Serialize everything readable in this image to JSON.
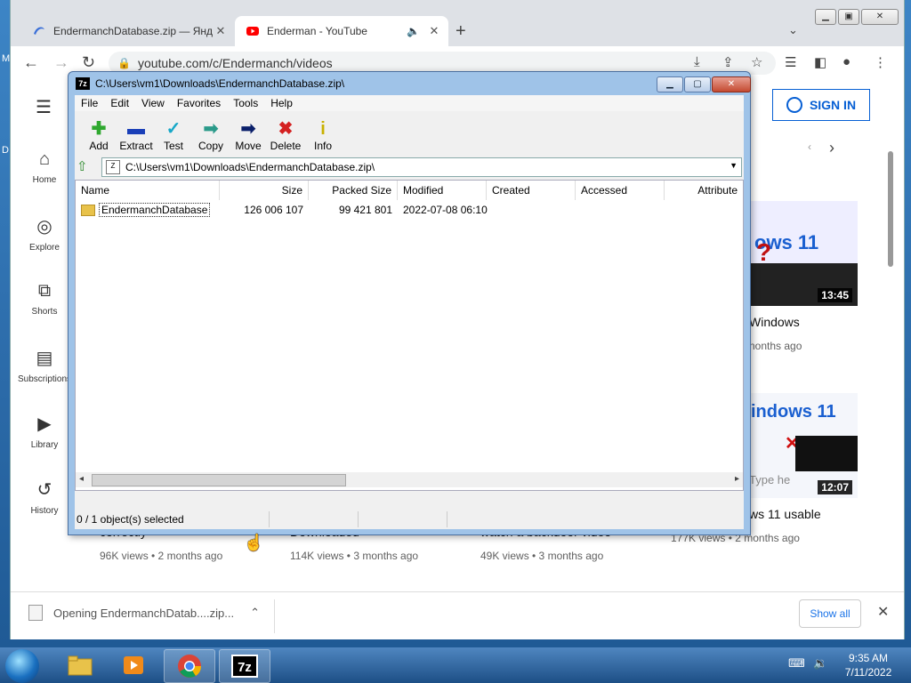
{
  "desktop": {
    "edge_letter_top": "M",
    "edge_letter_mid": "D"
  },
  "chrome": {
    "tabs": [
      {
        "title": "EndermanchDatabase.zip — Янд",
        "active": false
      },
      {
        "title": "Enderman - YouTube",
        "active": true
      }
    ],
    "new_tab": "+",
    "address": "youtube.com/c/Endermanch/videos"
  },
  "youtube": {
    "sidebar": [
      {
        "label": "Home",
        "icon": "home-icon"
      },
      {
        "label": "Explore",
        "icon": "compass-icon"
      },
      {
        "label": "Shorts",
        "icon": "shorts-icon"
      },
      {
        "label": "Subscriptions",
        "icon": "subscriptions-icon"
      },
      {
        "label": "Library",
        "icon": "library-icon"
      },
      {
        "label": "History",
        "icon": "history-icon"
      }
    ],
    "sign_in": "SIGN IN",
    "videos_right": [
      {
        "duration": "13:45",
        "title_fragment": "Windows",
        "meta_fragment": "nonths ago"
      },
      {
        "duration": "12:07",
        "title_fragment": "ws 11 usable",
        "meta_fragment": "177K views • 2 months ago"
      }
    ],
    "videos_bottom": [
      {
        "title_fragment": "correctly",
        "meta": "96K views • 2 months ago"
      },
      {
        "title_fragment": "Downloaded",
        "meta": "114K views • 3 months ago"
      },
      {
        "title_fragment": "watch a backdoor video",
        "meta": "49K views • 3 months ago"
      }
    ]
  },
  "download_bar": {
    "item": "Opening EndermanchDatab....zip...",
    "show_all": "Show all"
  },
  "sevenzip": {
    "title": "C:\\Users\\vm1\\Downloads\\EndermanchDatabase.zip\\",
    "menu": [
      "File",
      "Edit",
      "View",
      "Favorites",
      "Tools",
      "Help"
    ],
    "toolbar": [
      {
        "label": "Add",
        "icon": "add-icon",
        "glyph": "✚",
        "color": "#2fa82f"
      },
      {
        "label": "Extract",
        "icon": "extract-icon",
        "glyph": "▬",
        "color": "#1a3fb8"
      },
      {
        "label": "Test",
        "icon": "test-icon",
        "glyph": "✓",
        "color": "#18a8c8"
      },
      {
        "label": "Copy",
        "icon": "copy-icon",
        "glyph": "➡",
        "color": "#2a9a8a"
      },
      {
        "label": "Move",
        "icon": "move-icon",
        "glyph": "➡",
        "color": "#0a1f6a"
      },
      {
        "label": "Delete",
        "icon": "delete-icon",
        "glyph": "✖",
        "color": "#d42020"
      },
      {
        "label": "Info",
        "icon": "info-icon",
        "glyph": "i",
        "color": "#c8b000"
      }
    ],
    "path": "C:\\Users\\vm1\\Downloads\\EndermanchDatabase.zip\\",
    "columns": [
      "Name",
      "Size",
      "Packed Size",
      "Modified",
      "Created",
      "Accessed",
      "Attribute"
    ],
    "rows": [
      {
        "name": "EndermanchDatabase",
        "size": "126 006 107",
        "packed": "99 421 801",
        "modified": "2022-07-08 06:10",
        "created": "",
        "accessed": "",
        "attr": ""
      }
    ],
    "status": "0 / 1 object(s) selected"
  },
  "taskbar": {
    "time": "9:35 AM",
    "date": "7/11/2022"
  }
}
